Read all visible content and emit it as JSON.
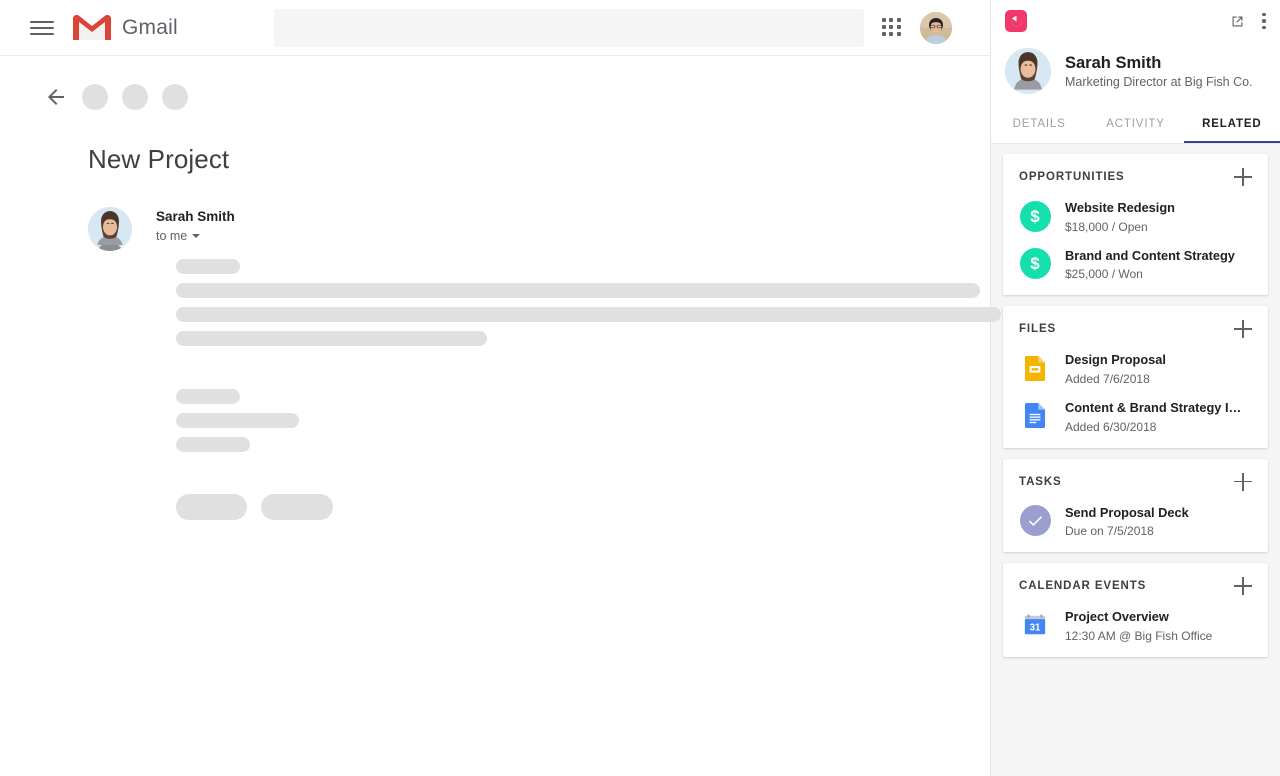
{
  "gmail": {
    "menu_icon": "hamburger-icon",
    "brand": "Gmail",
    "search_placeholder": "",
    "search_value": "",
    "apps_icon": "apps-grid-icon",
    "account_avatar": "account-avatar",
    "toolbar": {
      "back_icon": "back-arrow-icon",
      "placeholder_buttons": [
        "",
        "",
        ""
      ]
    },
    "message": {
      "subject": "New Project",
      "sender": "Sarah Smith",
      "recipients": "to me",
      "recipients_caret": "chevron-down-icon",
      "avatar": "sender-avatar"
    }
  },
  "panel": {
    "logo": "app-logo-icon",
    "open_external_icon": "open-in-new-icon",
    "more_icon": "more-vertical-icon",
    "contact": {
      "name": "Sarah Smith",
      "title": "Marketing Director at Big Fish Co.",
      "avatar": "contact-avatar"
    },
    "tabs": [
      {
        "label": "DETAILS",
        "active": false
      },
      {
        "label": "ACTIVITY",
        "active": false
      },
      {
        "label": "RELATED",
        "active": true
      }
    ],
    "accent_color": "#3b3f8c",
    "brand_color": "#f2386b",
    "sections": [
      {
        "title": "OPPORTUNITIES",
        "add_icon": "plus-icon",
        "items": [
          {
            "icon": "dollar-circle-icon",
            "title": "Website Redesign",
            "subtitle": "$18,000 / Open"
          },
          {
            "icon": "dollar-circle-icon",
            "title": "Brand and Content Strategy",
            "subtitle": "$25,000 / Won"
          }
        ]
      },
      {
        "title": "FILES",
        "add_icon": "plus-icon",
        "items": [
          {
            "icon": "google-slides-icon",
            "title": "Design Proposal",
            "subtitle": "Added 7/6/2018"
          },
          {
            "icon": "google-docs-icon",
            "title": "Content & Brand Strategy Invo…",
            "subtitle": "Added 6/30/2018"
          }
        ]
      },
      {
        "title": "TASKS",
        "add_icon": "plus-icon",
        "items": [
          {
            "icon": "check-circle-icon",
            "title": "Send Proposal Deck",
            "subtitle": "Due on 7/5/2018"
          }
        ]
      },
      {
        "title": "CALENDAR EVENTS",
        "add_icon": "plus-icon",
        "items": [
          {
            "icon": "google-calendar-icon",
            "title": "Project Overview",
            "subtitle": "12:30 AM @ Big Fish Office"
          }
        ]
      }
    ]
  }
}
